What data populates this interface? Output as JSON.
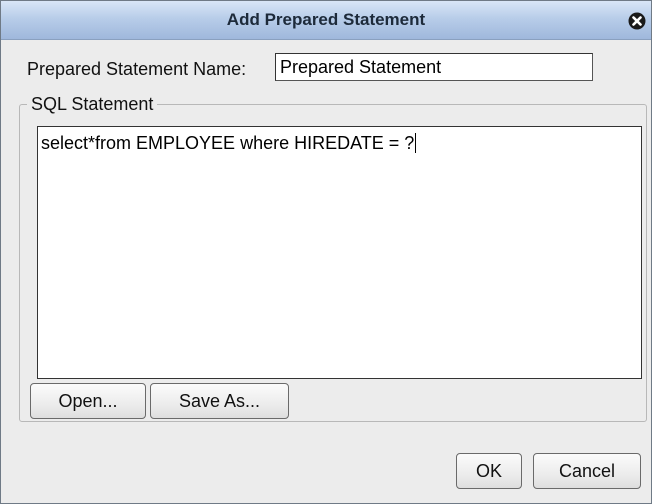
{
  "dialog": {
    "title": "Add Prepared Statement",
    "close_icon": "close-icon",
    "name_label": "Prepared Statement Name:",
    "name_value": "Prepared Statement",
    "sql_group_label": "SQL Statement",
    "sql_text": "select*from EMPLOYEE where HIREDATE = ?",
    "buttons": {
      "open": "Open...",
      "save_as": "Save As...",
      "ok": "OK",
      "cancel": "Cancel"
    }
  }
}
